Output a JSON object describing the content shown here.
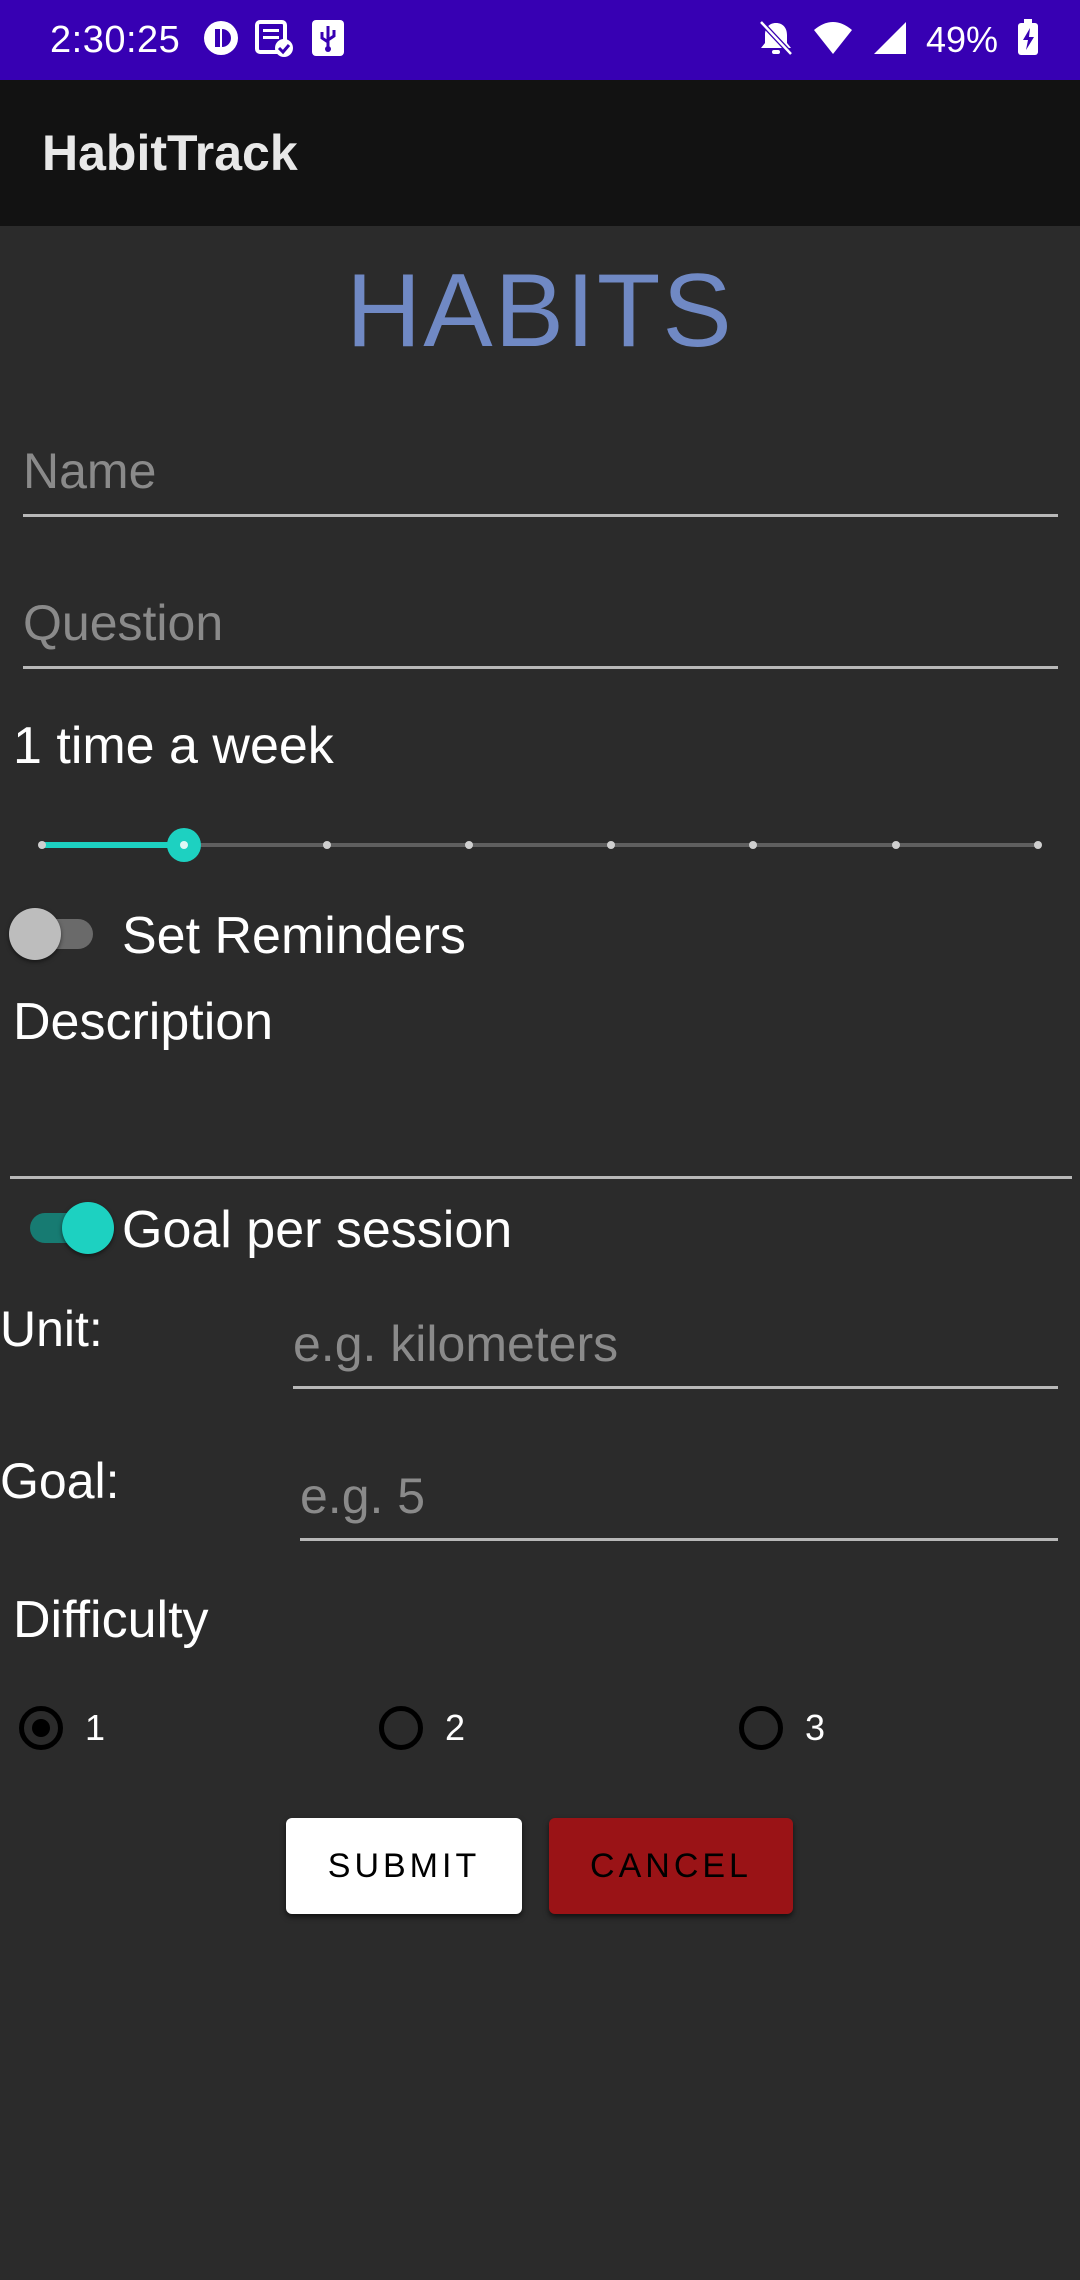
{
  "status_bar": {
    "time": "2:30:25",
    "battery": "49%",
    "left_icons": [
      "privacy-icon",
      "notes-icon",
      "usb-icon"
    ],
    "right_icons": [
      "bell-off-icon",
      "wifi-icon",
      "signal-icon",
      "battery-charging-icon"
    ]
  },
  "app_bar": {
    "title": "HabitTrack"
  },
  "headline": "HABITS",
  "form": {
    "name_placeholder": "Name",
    "question_placeholder": "Question",
    "frequency_label": "1 time a week",
    "frequency_slider": {
      "min": 0,
      "max": 7,
      "value": 1
    },
    "reminders_label": "Set Reminders",
    "reminders_enabled": false,
    "description_label": "Description",
    "goal_toggle_label": "Goal per session",
    "goal_enabled": true,
    "unit_label": "Unit:",
    "unit_placeholder": "e.g. kilometers",
    "goal_label": "Goal:",
    "goal_placeholder": "e.g. 5",
    "difficulty_label": "Difficulty",
    "difficulty_options": [
      "1",
      "2",
      "3"
    ],
    "difficulty_selected": "1"
  },
  "buttons": {
    "submit": "SUBMIT",
    "cancel": "CANCEL"
  },
  "colors": {
    "status_bar": "#3700b3",
    "app_bar": "#121212",
    "background": "#2b2b2b",
    "headline": "#7089c4",
    "accent": "#1dd1c1",
    "cancel": "#9a1316"
  }
}
